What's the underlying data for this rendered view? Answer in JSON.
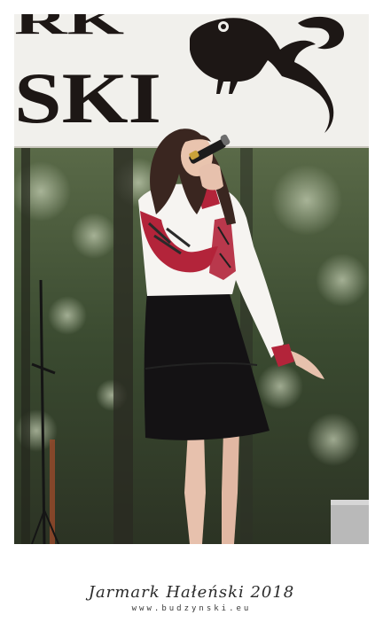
{
  "photo": {
    "banner_text_top": "RK",
    "banner_text_main": "SKI",
    "colors": {
      "banner_bg": "#f1f0ec",
      "banner_ink": "#1d1715",
      "foliage_dark": "#2f3b26",
      "foliage_mid": "#4f6140",
      "foliage_light": "#8a9a7a",
      "blouse": "#f6f4f1",
      "embroidery": "#b3243a",
      "skirt": "#141214",
      "skin": "#e7c1ad",
      "hair": "#3a2620"
    },
    "icons": [
      "bird-emblem-icon",
      "microphone-icon",
      "microphone-stand-icon"
    ]
  },
  "caption": {
    "title": "Jarmark Hałeński 2018",
    "url": "www.budzynski.eu"
  }
}
